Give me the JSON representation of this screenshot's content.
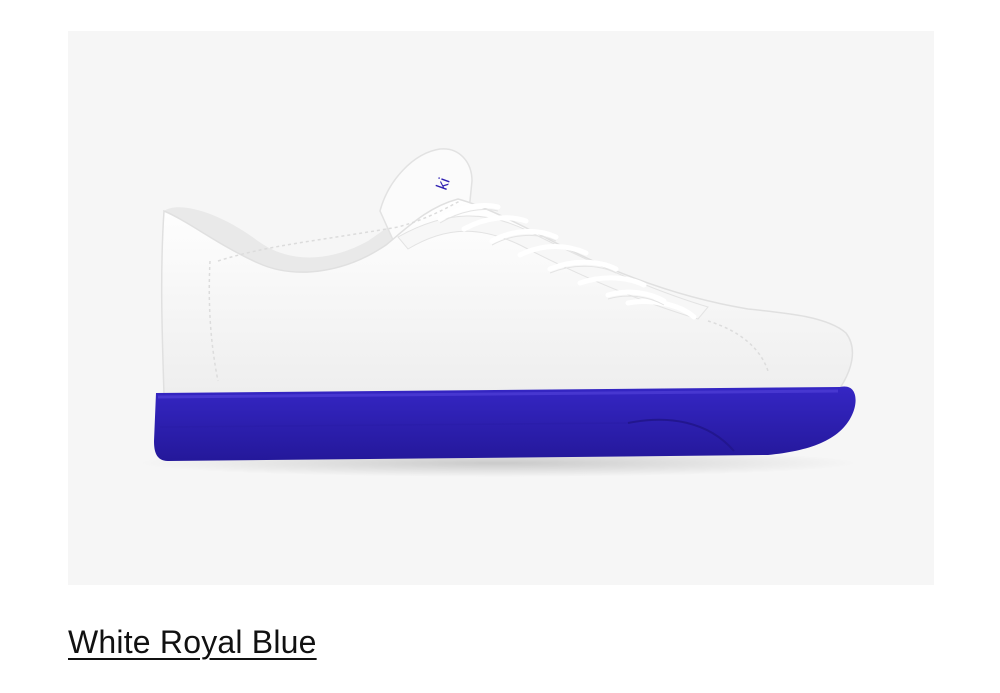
{
  "product": {
    "variant_name": "White Royal Blue",
    "image_alt": "White Royal Blue sneaker",
    "brand_mark": "ki",
    "colors": {
      "upper": "#ffffff",
      "sole": "#2f20b2",
      "background": "#f6f6f6",
      "text": "#111111"
    }
  }
}
